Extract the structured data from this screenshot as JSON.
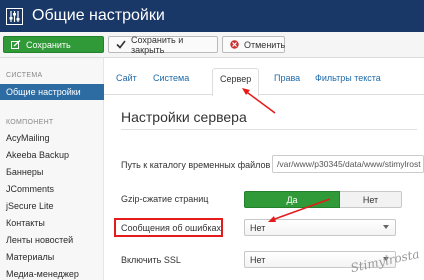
{
  "header": {
    "title": "Общие настройки",
    "icon": "sliders-icon"
  },
  "toolbar": {
    "save_label": "Сохранить",
    "save_close_label": "Сохранить и закрыть",
    "cancel_label": "Отменить"
  },
  "sidebar": {
    "system_heading": "СИСТЕМА",
    "system_items": [
      "Общие настройки"
    ],
    "component_heading": "КОМПОНЕНТ",
    "component_items": [
      "AcyMailing",
      "Akeeba Backup",
      "Баннеры",
      "JComments",
      "jSecure Lite",
      "Контакты",
      "Ленты новостей",
      "Материалы",
      "Медиа-менеджер"
    ]
  },
  "tabs": [
    "Сайт",
    "Система",
    "Сервер",
    "Права",
    "Фильтры текста"
  ],
  "main": {
    "section_title": "Настройки сервера",
    "tmp_path_label": "Путь к каталогу временных файлов",
    "tmp_path_value": "/var/www/p30345/data/www/stimylrost",
    "gzip_label": "Gzip-сжатие страниц",
    "gzip_yes": "Да",
    "gzip_no": "Нет",
    "errors_label": "Сообщения об ошибках",
    "errors_value": "Нет",
    "ssl_label": "Включить SSL",
    "ssl_value": "Нет"
  },
  "watermark": "Stimylrosta",
  "colors": {
    "header": "#1a3867",
    "accent_green": "#2f9a37",
    "active_blue": "#2d6ca2",
    "annotation_red": "#e51b1b"
  }
}
